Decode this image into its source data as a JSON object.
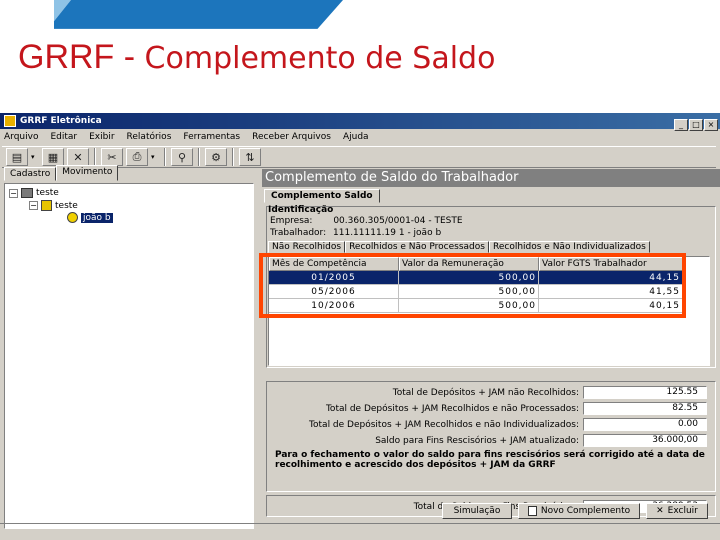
{
  "slide": {
    "title_bold": "GRRF",
    "title_sep": " - ",
    "title_rest": "Complemento de Saldo",
    "title_color": "#c4161c"
  },
  "window": {
    "title": "GRRF Eletrônica",
    "menu": [
      "Arquivo",
      "Editar",
      "Exibir",
      "Relatórios",
      "Ferramentas",
      "Receber Arquivos",
      "Ajuda"
    ],
    "mdi_buttons": [
      "_",
      "□",
      "×"
    ]
  },
  "toolbar": {
    "icons": [
      "new-icon",
      "open-icon",
      "delete-icon",
      "cut-icon",
      "print-icon",
      "find-icon",
      "settings-icon",
      "help-icon"
    ]
  },
  "left_panel": {
    "tabs": [
      "Cadastro",
      "Movimento"
    ],
    "tree": [
      {
        "label": "teste",
        "level": 0
      },
      {
        "label": "teste",
        "level": 1
      },
      {
        "label": "joão b",
        "level": 2
      }
    ]
  },
  "child": {
    "title": "Complemento de Saldo do Trabalhador",
    "tab": "Complemento Saldo",
    "ident_title": "Identificação",
    "empresa_label": "Empresa:",
    "empresa_value": "00.360.305/0001-04 - TESTE",
    "trabalhador_label": "Trabalhador:",
    "trabalhador_value": "111.11111.19 1 - joão b",
    "subtabs": [
      "Não Recolhidos",
      "Recolhidos e Não Processados",
      "Recolhidos e Não Individualizados"
    ],
    "grid": {
      "headers": [
        "Mês de Competência",
        "Valor da Remuneração",
        "Valor FGTS Trabalhador"
      ],
      "rows": [
        [
          "01/2005",
          "500,00",
          "44,15"
        ],
        [
          "05/2006",
          "500,00",
          "41,55"
        ],
        [
          "10/2006",
          "500,00",
          "40,15"
        ]
      ]
    },
    "totals": [
      {
        "label": "Total de Depósitos + JAM não Recolhidos:",
        "value": "125.55"
      },
      {
        "label": "Total de Depósitos + JAM Recolhidos e não Processados:",
        "value": "82.55"
      },
      {
        "label": "Total de Depósitos + JAM Recolhidos e não Individualizados:",
        "value": "0.00"
      },
      {
        "label": "Saldo para Fins Rescisórios + JAM atualizado:",
        "value": "36.000,00"
      }
    ],
    "note": "Para o fechamento o valor do saldo para fins rescisórios será corrigido até a data de recolhimento e acrescido dos depósitos + JAM da GRRF",
    "final_label": "Total do Saldo para Fins Rescisórios :",
    "final_value": "36.289,53",
    "buttons": [
      "Simulação",
      "Novo Complemento",
      "Excluir"
    ]
  },
  "colors": {
    "highlight": "#ff4500",
    "selection": "#0a246a"
  }
}
